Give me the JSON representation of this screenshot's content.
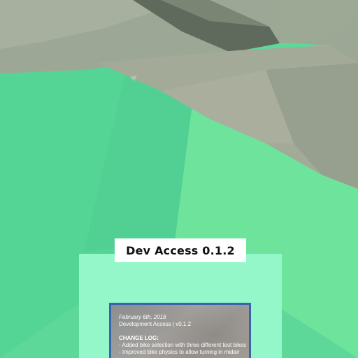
{
  "title_badge": {
    "text": "Dev Access 0.1.2"
  },
  "changelog": {
    "date": "February 6th, 2018",
    "build": "Development Access | v0.1.2",
    "heading": "CHANGE LOG:",
    "entries": [
      "- Added bike selection with three different test bikes",
      "- Improved bike physics to allow turning in midair"
    ]
  },
  "colors": {
    "ground": "#5ed899",
    "rock": "#9ca895",
    "panel": "#94f7c9",
    "card_border": "#3d63ad"
  }
}
